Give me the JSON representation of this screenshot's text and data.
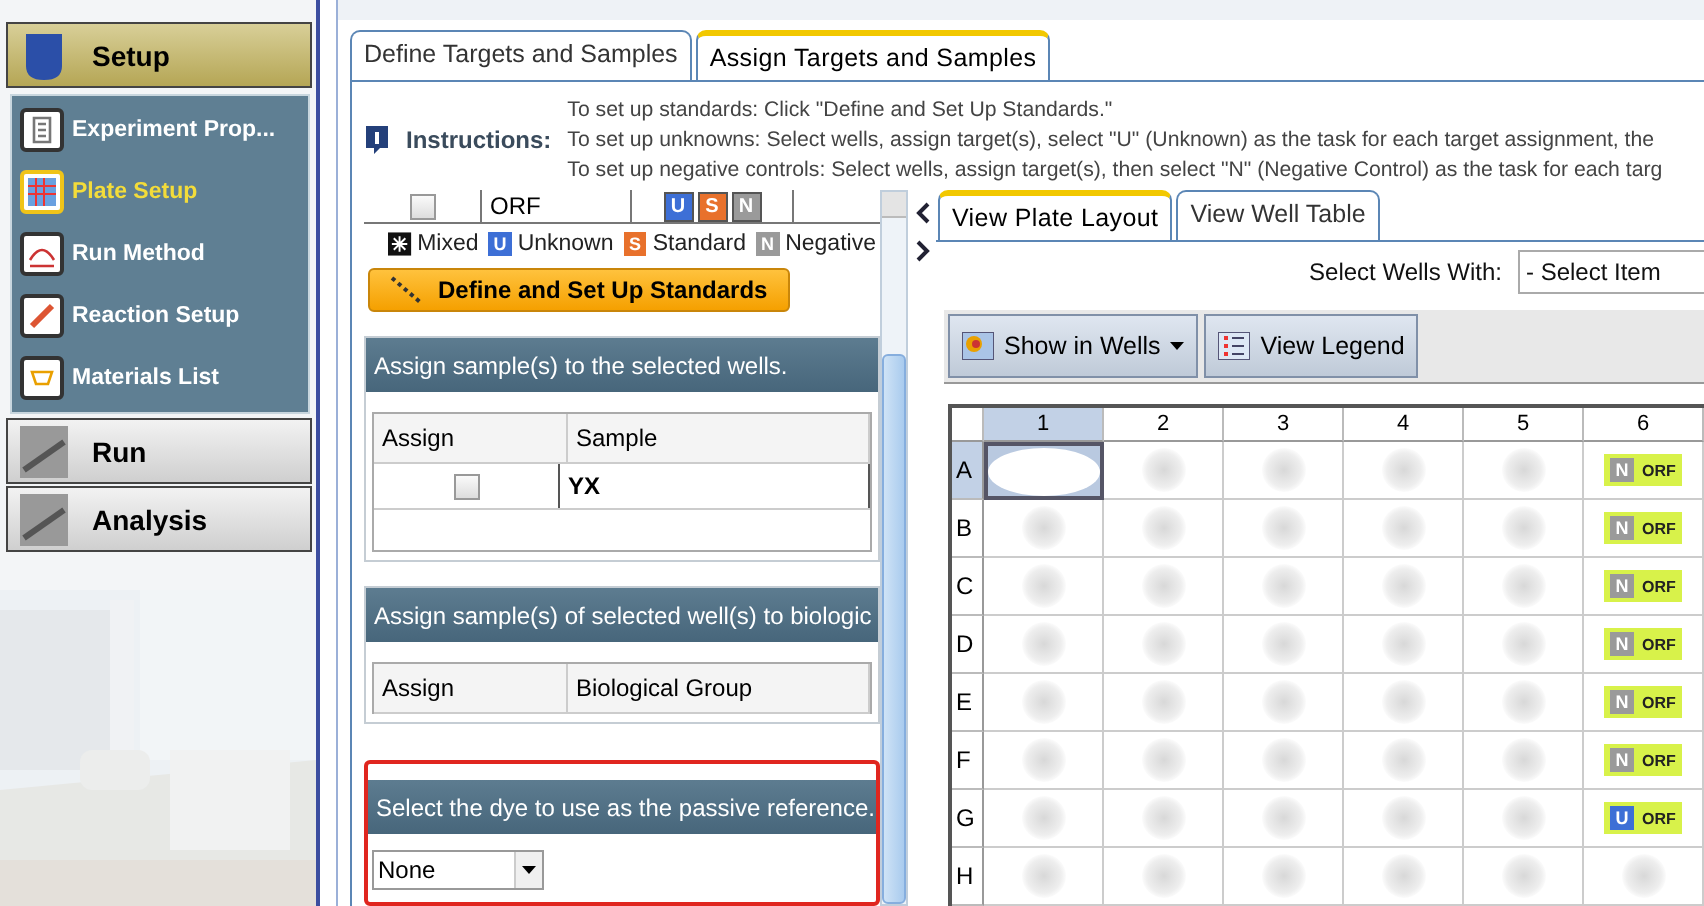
{
  "sidebar": {
    "sections": [
      {
        "label": "Setup",
        "expanded": true,
        "items": [
          {
            "label": "Experiment Prop...",
            "selected": false
          },
          {
            "label": "Plate Setup",
            "selected": true
          },
          {
            "label": "Run Method",
            "selected": false
          },
          {
            "label": "Reaction Setup",
            "selected": false
          },
          {
            "label": "Materials List",
            "selected": false
          }
        ]
      },
      {
        "label": "Run",
        "expanded": false
      },
      {
        "label": "Analysis",
        "expanded": false
      }
    ]
  },
  "tabs": [
    {
      "label": "Define Targets and Samples",
      "selected": false
    },
    {
      "label": "Assign Targets and Samples",
      "selected": true
    }
  ],
  "instructions": {
    "title": "Instructions:",
    "lines": [
      "To set up standards: Click \"Define and Set Up Standards.\"",
      "To set up unknowns: Select wells, assign target(s), select \"U\" (Unknown) as the task for each target assignment, the",
      "To set up negative controls: Select wells, assign target(s), then select \"N\" (Negative Control) as the task for each targ"
    ]
  },
  "targets": {
    "rows": [
      {
        "checked": false,
        "name": "ORF",
        "tasks": [
          {
            "letter": "U",
            "kind": "unknown"
          },
          {
            "letter": "S",
            "kind": "standard"
          },
          {
            "letter": "N",
            "kind": "negative"
          }
        ]
      }
    ],
    "legend": [
      {
        "kind": "mixed",
        "label": "Mixed"
      },
      {
        "kind": "unknown",
        "letter": "U",
        "label": "Unknown"
      },
      {
        "kind": "standard",
        "letter": "S",
        "label": "Standard"
      },
      {
        "kind": "negative",
        "letter": "N",
        "label": "Negative"
      }
    ],
    "button": "Define and Set Up Standards"
  },
  "samples": {
    "header": "Assign sample(s) to the selected wells.",
    "columns": [
      "Assign",
      "Sample"
    ],
    "rows": [
      {
        "checked": false,
        "name": "YX"
      }
    ]
  },
  "groups": {
    "header": "Assign sample(s) of selected well(s) to biologic",
    "columns": [
      "Assign",
      "Biological Group"
    ]
  },
  "passive_reference": {
    "header": "Select the dye to use as the passive reference.",
    "value": "None"
  },
  "view_tabs": [
    {
      "label": "View Plate Layout",
      "selected": true
    },
    {
      "label": "View Well Table",
      "selected": false
    }
  ],
  "select_wells": {
    "label": "Select Wells With:",
    "value": "- Select Item"
  },
  "toolbar": [
    {
      "label": "Show in Wells",
      "kind": "menu"
    },
    {
      "label": "View Legend",
      "kind": "legend"
    }
  ],
  "plate": {
    "columns": [
      "1",
      "2",
      "3",
      "4",
      "5",
      "6"
    ],
    "rows": [
      {
        "label": "A",
        "wells": [
          {
            "selected": true
          },
          {
            "selected": false
          },
          {
            "selected": false
          },
          {
            "selected": false
          },
          {
            "selected": false
          },
          {
            "selected": false,
            "task": "N",
            "kind": "negative",
            "target": "ORF"
          }
        ]
      },
      {
        "label": "B",
        "wells": [
          {
            "selected": false
          },
          {
            "selected": false
          },
          {
            "selected": false
          },
          {
            "selected": false
          },
          {
            "selected": false
          },
          {
            "selected": false,
            "task": "N",
            "kind": "negative",
            "target": "ORF"
          }
        ]
      },
      {
        "label": "C",
        "wells": [
          {
            "selected": false
          },
          {
            "selected": false
          },
          {
            "selected": false
          },
          {
            "selected": false
          },
          {
            "selected": false
          },
          {
            "selected": false,
            "task": "N",
            "kind": "negative",
            "target": "ORF"
          }
        ]
      },
      {
        "label": "D",
        "wells": [
          {
            "selected": false
          },
          {
            "selected": false
          },
          {
            "selected": false
          },
          {
            "selected": false
          },
          {
            "selected": false
          },
          {
            "selected": false,
            "task": "N",
            "kind": "negative",
            "target": "ORF"
          }
        ]
      },
      {
        "label": "E",
        "wells": [
          {
            "selected": false
          },
          {
            "selected": false
          },
          {
            "selected": false
          },
          {
            "selected": false
          },
          {
            "selected": false
          },
          {
            "selected": false,
            "task": "N",
            "kind": "negative",
            "target": "ORF"
          }
        ]
      },
      {
        "label": "F",
        "wells": [
          {
            "selected": false
          },
          {
            "selected": false
          },
          {
            "selected": false
          },
          {
            "selected": false
          },
          {
            "selected": false
          },
          {
            "selected": false,
            "task": "N",
            "kind": "negative",
            "target": "ORF"
          }
        ]
      },
      {
        "label": "G",
        "wells": [
          {
            "selected": false
          },
          {
            "selected": false
          },
          {
            "selected": false
          },
          {
            "selected": false
          },
          {
            "selected": false
          },
          {
            "selected": false,
            "task": "U",
            "kind": "unknown",
            "target": "ORF"
          }
        ]
      },
      {
        "label": "H",
        "wells": [
          {
            "selected": false
          },
          {
            "selected": false
          },
          {
            "selected": false
          },
          {
            "selected": false
          },
          {
            "selected": false
          },
          {
            "selected": false
          }
        ]
      }
    ]
  }
}
